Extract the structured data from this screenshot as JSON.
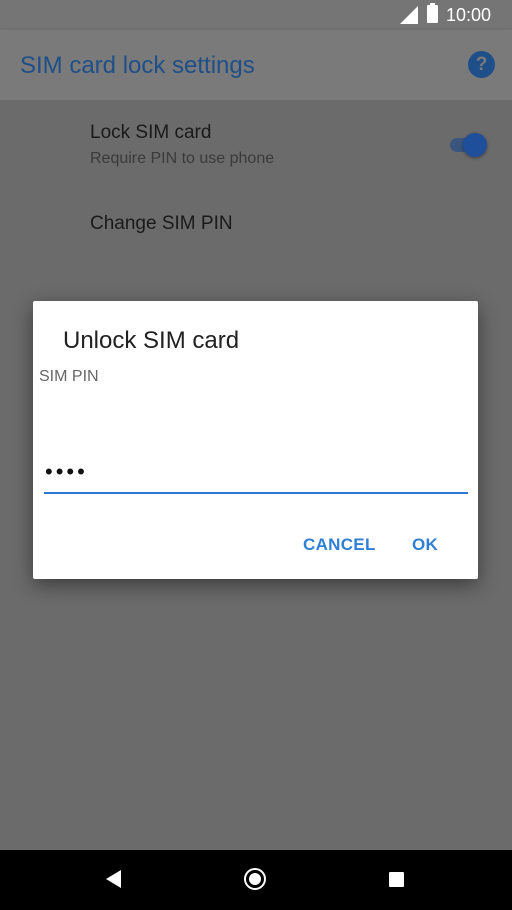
{
  "status_bar": {
    "time": "10:00"
  },
  "app_bar": {
    "title": "SIM card lock settings",
    "help_icon": "help-circle-icon"
  },
  "settings": {
    "lock_sim": {
      "title": "Lock SIM card",
      "subtitle": "Require PIN to use phone",
      "enabled": true
    },
    "change_pin": {
      "title": "Change SIM PIN"
    }
  },
  "dialog": {
    "title": "Unlock SIM card",
    "field_label": "SIM PIN",
    "pin_value": "••••",
    "cancel_label": "CANCEL",
    "ok_label": "OK"
  },
  "colors": {
    "accent": "#2f7fd6",
    "switch_on": "#1f4f9a",
    "scrim": "#6b6b6b"
  }
}
